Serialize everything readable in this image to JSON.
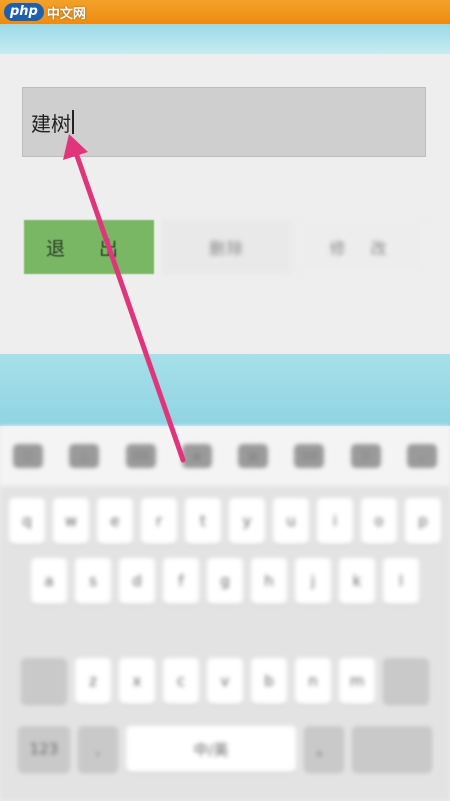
{
  "watermark": {
    "php": "php",
    "site": "中文网"
  },
  "name_input": {
    "value": "建树"
  },
  "buttons": {
    "exit": "退 出",
    "delete": "删除",
    "modify": "修 改"
  },
  "keyboard": {
    "toolbar": [
      "☺",
      "上",
      "⌨",
      "◉",
      "▦",
      "⌨",
      "☰",
      "⌄"
    ],
    "row1": [
      "q",
      "w",
      "e",
      "r",
      "t",
      "y",
      "u",
      "i",
      "o",
      "p"
    ],
    "row2": [
      "a",
      "s",
      "d",
      "f",
      "g",
      "h",
      "j",
      "k",
      "l"
    ],
    "row3": [
      "z",
      "x",
      "c",
      "v",
      "b",
      "n",
      "m"
    ],
    "row4": [
      "123",
      ",",
      "中/英",
      "。"
    ]
  },
  "colors": {
    "arrow": "#e0357a",
    "exit_button": "#79b764",
    "top_strip": "#ee8c12"
  }
}
